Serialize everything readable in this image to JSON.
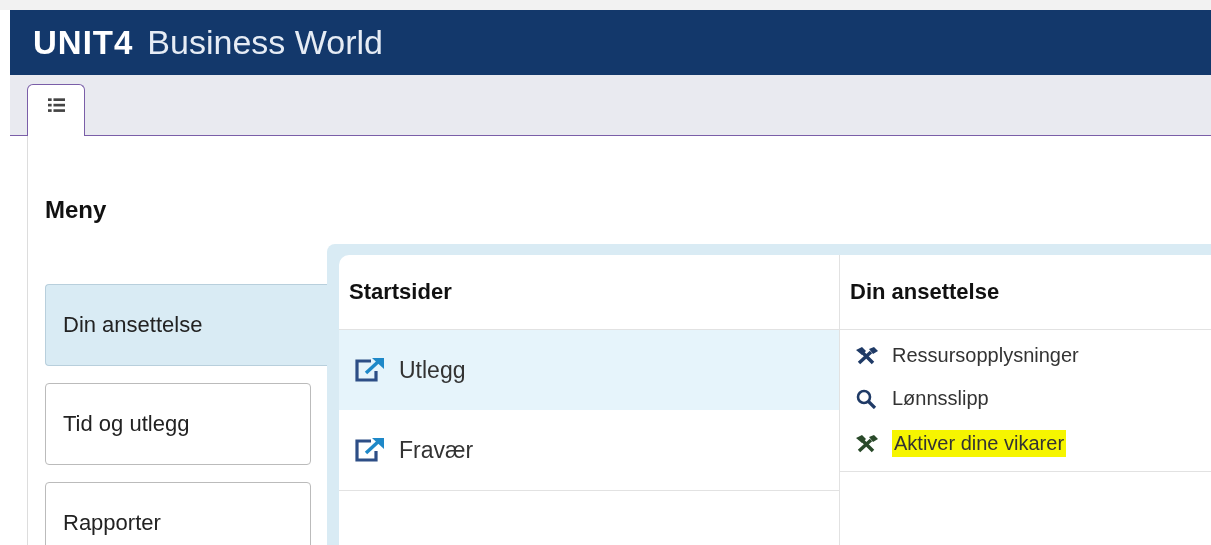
{
  "header": {
    "brand": "UNIT4",
    "product": "Business World"
  },
  "tabs": [
    {
      "kind": "list",
      "selected": true
    }
  ],
  "menu": {
    "title": "Meny",
    "items": [
      {
        "label": "Din ansettelse",
        "selected": true
      },
      {
        "label": "Tid og utlegg",
        "selected": false
      },
      {
        "label": "Rapporter",
        "selected": false
      }
    ]
  },
  "columns": [
    {
      "title": "Startsider",
      "links": [
        {
          "label": "Utlegg",
          "kind": "external",
          "selected": true,
          "highlighted": false
        },
        {
          "label": "Fravær",
          "kind": "external",
          "selected": false,
          "highlighted": false
        }
      ]
    },
    {
      "title": "Din ansettelse",
      "links": [
        {
          "label": "Ressursopplysninger",
          "kind": "tools",
          "selected": false,
          "highlighted": false
        },
        {
          "label": "Lønnsslipp",
          "kind": "search",
          "selected": false,
          "highlighted": false
        },
        {
          "label": "Aktiver dine vikarer",
          "kind": "tools",
          "selected": false,
          "highlighted": true
        }
      ]
    }
  ]
}
